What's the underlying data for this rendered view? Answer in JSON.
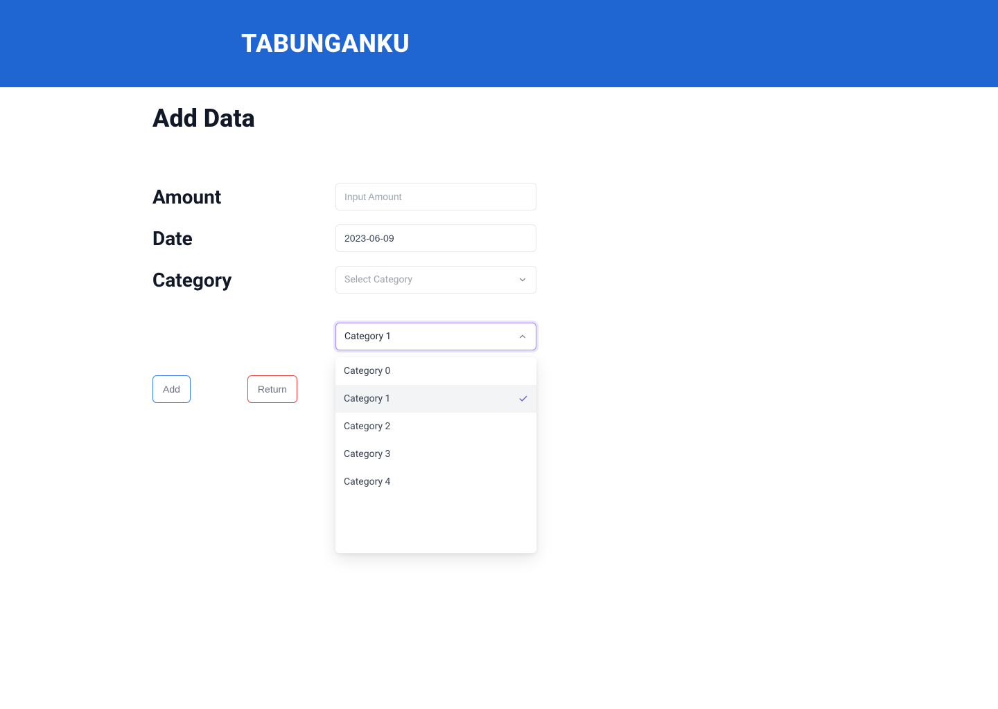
{
  "header": {
    "brand": "TABUNGANKU"
  },
  "page": {
    "title": "Add Data"
  },
  "form": {
    "amount": {
      "label": "Amount",
      "placeholder": "Input Amount",
      "value": ""
    },
    "date": {
      "label": "Date",
      "value": "2023-06-09"
    },
    "category": {
      "label": "Category",
      "placeholder": "Select Category",
      "value": ""
    },
    "category2": {
      "selected_label": "Category 1",
      "selected_index": 1,
      "options": [
        {
          "label": "Category 0"
        },
        {
          "label": "Category 1"
        },
        {
          "label": "Category 2"
        },
        {
          "label": "Category 3"
        },
        {
          "label": "Category 4"
        }
      ]
    }
  },
  "actions": {
    "add_label": "Add",
    "return_label": "Return"
  }
}
